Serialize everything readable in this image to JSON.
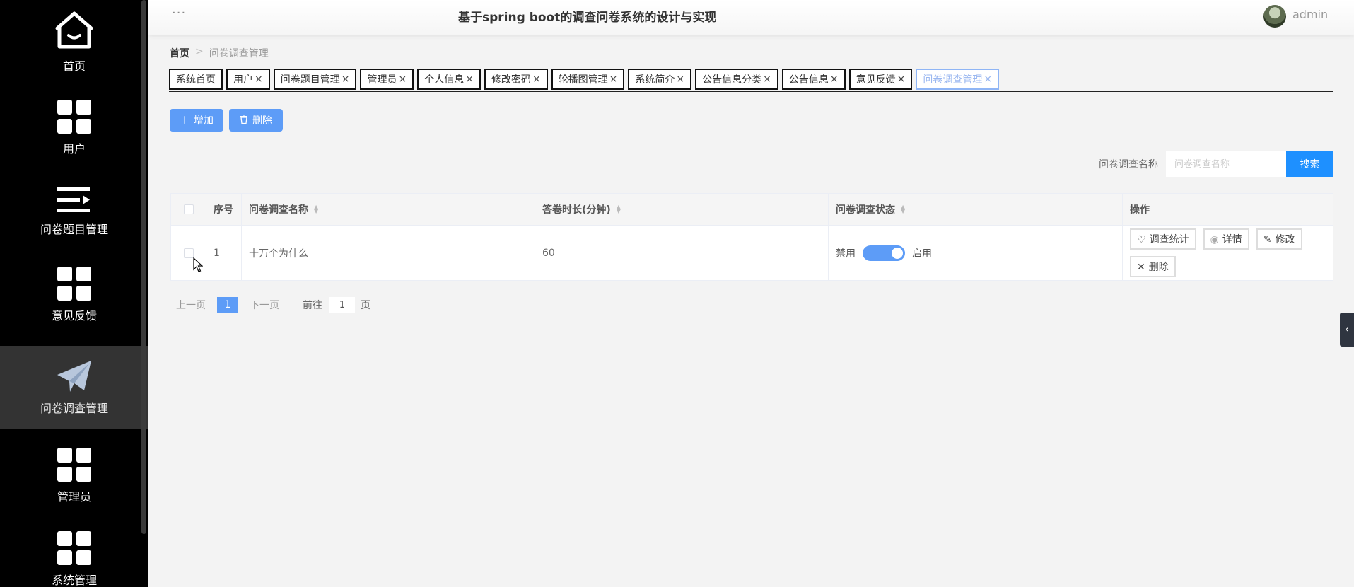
{
  "header": {
    "menu_dots": "···",
    "title": "基于spring boot的调查问卷系统的设计与实现",
    "user": "admin"
  },
  "sidebar": {
    "items": [
      {
        "label": "首页",
        "icon": "home-icon"
      },
      {
        "label": "用户",
        "icon": "grid-icon"
      },
      {
        "label": "问卷题目管理",
        "icon": "list-icon"
      },
      {
        "label": "意见反馈",
        "icon": "grid-icon"
      },
      {
        "label": "问卷调查管理",
        "icon": "paper-plane-icon",
        "active": true
      },
      {
        "label": "管理员",
        "icon": "grid-icon"
      },
      {
        "label": "系统管理",
        "icon": "grid-icon"
      }
    ]
  },
  "breadcrumb": {
    "home": "首页",
    "sep": ">",
    "current": "问卷调查管理"
  },
  "tabs": [
    {
      "label": "系统首页",
      "closable": false
    },
    {
      "label": "用户",
      "closable": true
    },
    {
      "label": "问卷题目管理",
      "closable": true
    },
    {
      "label": "管理员",
      "closable": true
    },
    {
      "label": "个人信息",
      "closable": true
    },
    {
      "label": "修改密码",
      "closable": true
    },
    {
      "label": "轮播图管理",
      "closable": true
    },
    {
      "label": "系统简介",
      "closable": true
    },
    {
      "label": "公告信息分类",
      "closable": true
    },
    {
      "label": "公告信息",
      "closable": true
    },
    {
      "label": "意见反馈",
      "closable": true
    },
    {
      "label": "问卷调查管理",
      "closable": true,
      "active": true
    }
  ],
  "actions": {
    "add": "增加",
    "delete": "删除"
  },
  "search": {
    "label": "问卷调查名称",
    "placeholder": "问卷调查名称",
    "value": "",
    "button": "搜索"
  },
  "table": {
    "headers": {
      "index": "序号",
      "name": "问卷调查名称",
      "duration": "答卷时长(分钟)",
      "status": "问卷调查状态",
      "ops": "操作"
    },
    "rows": [
      {
        "index": "1",
        "name": "十万个为什么",
        "duration": "60",
        "status_off": "禁用",
        "status_on": "启用",
        "enabled": true,
        "ops": {
          "stats": "调查统计",
          "detail": "详情",
          "edit": "修改",
          "delete": "删除"
        }
      }
    ]
  },
  "pagination": {
    "prev": "上一页",
    "current": "1",
    "next": "下一页",
    "goto": "前往",
    "goto_value": "1",
    "suffix": "页"
  },
  "colors": {
    "sidebar_bg": "#000000",
    "accent": "#5d9cf7",
    "search_button": "#1e90ff",
    "active_tab": "#8fb5f5"
  }
}
